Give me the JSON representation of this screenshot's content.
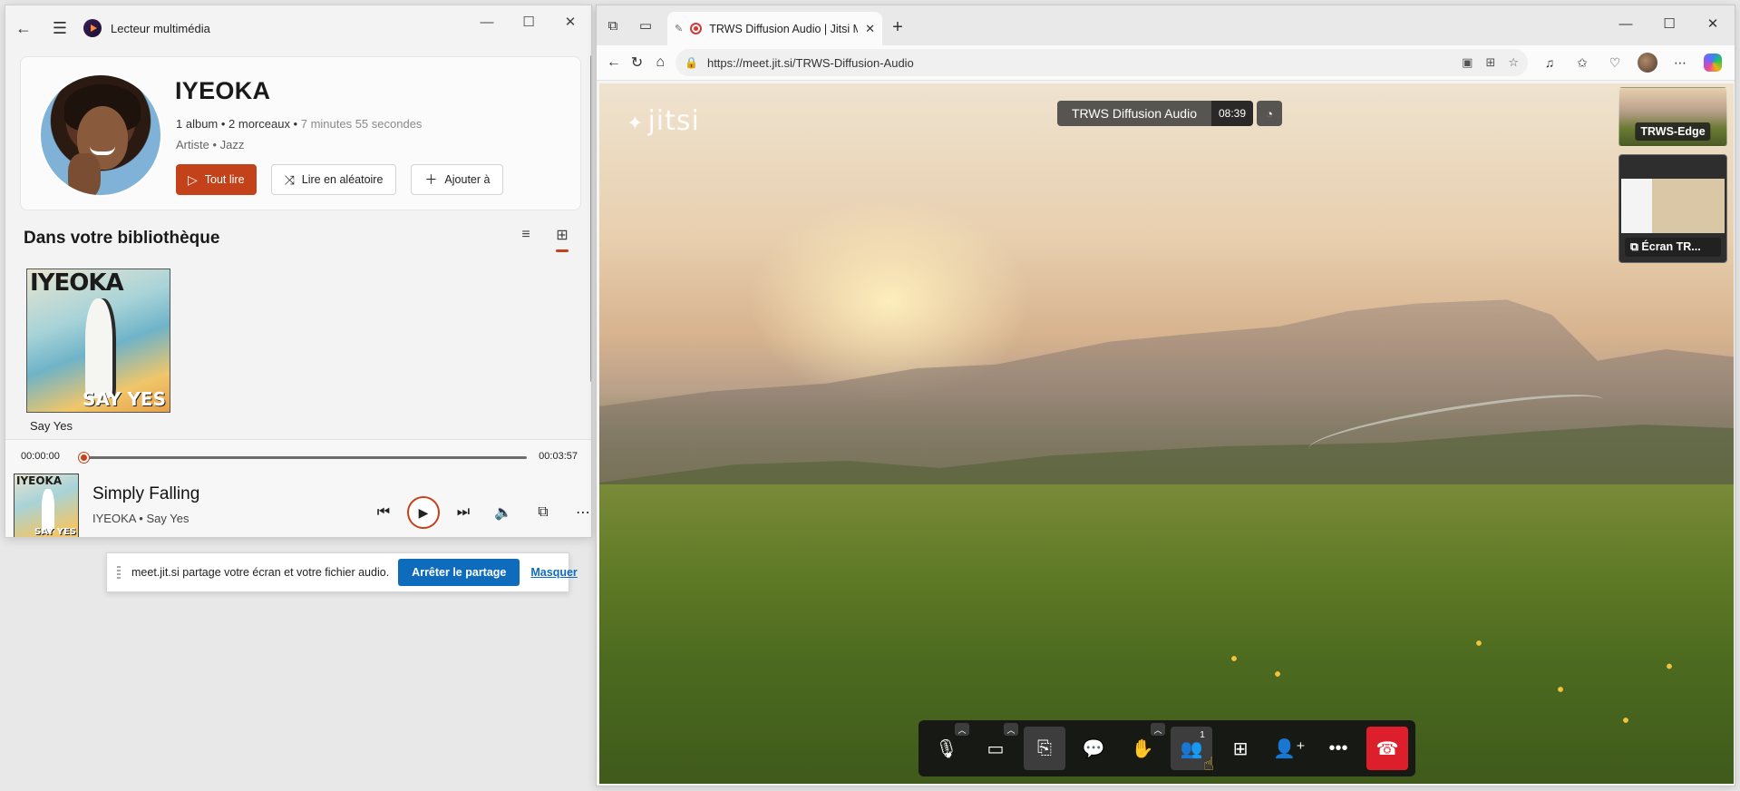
{
  "media_player": {
    "title": "Lecteur multimédia",
    "artist": {
      "name": "IYEOKA",
      "stats_main": "1 album • 2 morceaux •",
      "stats_duration": "7 minutes 55 secondes",
      "genre": "Artiste • Jazz"
    },
    "buttons": {
      "play_all": "Tout lire",
      "shuffle": "Lire en aléatoire",
      "add_to": "Ajouter à"
    },
    "library": {
      "title": "Dans votre bibliothèque",
      "albums": [
        {
          "title": "Say Yes",
          "cover_artist": "IYEOKA",
          "cover_text": "SAY YES"
        }
      ]
    },
    "progress": {
      "current": "00:00:00",
      "total": "00:03:57",
      "fraction": 0.0
    },
    "now_playing": {
      "title": "Simply Falling",
      "subtitle": "IYEOKA • Say Yes",
      "cover_artist": "IYEOKA",
      "cover_text": "SAY YES"
    }
  },
  "share_banner": {
    "text": "meet.jit.si partage votre écran et votre fichier audio.",
    "stop_label": "Arrêter le partage",
    "hide_label": "Masquer"
  },
  "browser": {
    "tab_title": "TRWS Diffusion Audio | Jitsi Meet",
    "url": "https://meet.jit.si/TRWS-Diffusion-Audio"
  },
  "jitsi": {
    "logo": "jitsi",
    "meeting_name": "TRWS Diffusion Audio",
    "timer": "08:39",
    "participants": [
      {
        "label": "TRWS-Edge"
      },
      {
        "label": "Écran TR..."
      }
    ],
    "participants_count": "1"
  },
  "colors": {
    "accent_player": "#c4421a",
    "accent_link": "#0f6cbd",
    "hangup": "#dd1f2c"
  }
}
